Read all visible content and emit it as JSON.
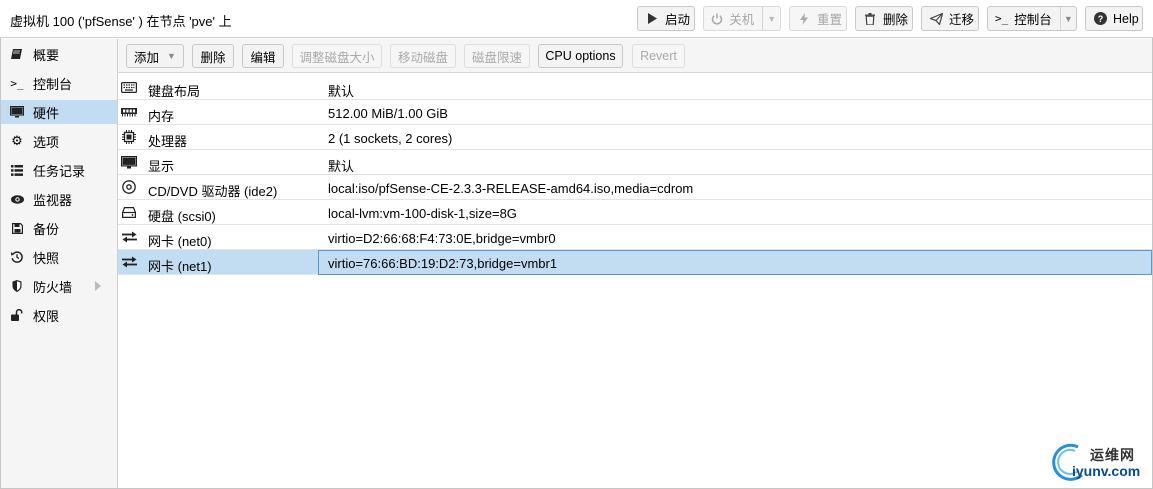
{
  "header": {
    "title": "虚拟机 100 ('pfSense' ) 在节点 'pve' 上",
    "buttons": {
      "start": {
        "label": "启动",
        "icon": "play-icon"
      },
      "shutdown": {
        "label": "关机",
        "icon": "power-icon"
      },
      "reset": {
        "label": "重置",
        "icon": "bolt-icon"
      },
      "remove": {
        "label": "删除",
        "icon": "trash-icon"
      },
      "migrate": {
        "label": "迁移",
        "icon": "paper-plane-icon"
      },
      "console": {
        "label": "控制台",
        "icon": "terminal-icon"
      },
      "help": {
        "label": "Help",
        "icon": "question-circle-icon"
      }
    }
  },
  "sidebar": {
    "items": [
      {
        "label": "概要",
        "icon": "book-icon"
      },
      {
        "label": "控制台",
        "icon": "terminal-icon"
      },
      {
        "label": "硬件",
        "icon": "desktop-icon",
        "active": true
      },
      {
        "label": "选项",
        "icon": "gear-icon"
      },
      {
        "label": "任务记录",
        "icon": "list-icon"
      },
      {
        "label": "监视器",
        "icon": "eye-icon"
      },
      {
        "label": "备份",
        "icon": "floppy-icon"
      },
      {
        "label": "快照",
        "icon": "history-icon"
      },
      {
        "label": "防火墙",
        "icon": "shield-icon"
      },
      {
        "label": "权限",
        "icon": "unlock-icon"
      }
    ]
  },
  "toolbar": {
    "add": "添加",
    "remove": "删除",
    "edit": "编辑",
    "resize_disk": "调整磁盘大小",
    "move_disk": "移动磁盘",
    "disk_throttle": "磁盘限速",
    "cpu_options": "CPU options",
    "revert": "Revert"
  },
  "hardware": {
    "rows": [
      {
        "key": "键盘布局",
        "value": "默认",
        "icon": "keyboard-icon"
      },
      {
        "key": "内存",
        "value": "512.00 MiB/1.00 GiB",
        "icon": "memory-icon"
      },
      {
        "key": "处理器",
        "value": "2 (1 sockets, 2 cores)",
        "icon": "cpu-icon"
      },
      {
        "key": "显示",
        "value": "默认",
        "icon": "desktop-icon"
      },
      {
        "key": "CD/DVD 驱动器 (ide2)",
        "value": "local:iso/pfSense-CE-2.3.3-RELEASE-amd64.iso,media=cdrom",
        "icon": "cdrom-icon"
      },
      {
        "key": "硬盘 (scsi0)",
        "value": "local-lvm:vm-100-disk-1,size=8G",
        "icon": "hdd-icon"
      },
      {
        "key": "网卡 (net0)",
        "value": "virtio=D2:66:68:F4:73:0E,bridge=vmbr0",
        "icon": "exchange-icon"
      },
      {
        "key": "网卡 (net1)",
        "value": "virtio=76:66:BD:19:D2:73,bridge=vmbr1",
        "icon": "exchange-icon",
        "selected": true
      }
    ]
  },
  "watermark": {
    "cn": "运维网",
    "en": "iyunv.com"
  },
  "colors": {
    "selection": "#c2ddf2",
    "selection_border": "#5d97c9",
    "panel_bg": "#f5f5f5"
  }
}
